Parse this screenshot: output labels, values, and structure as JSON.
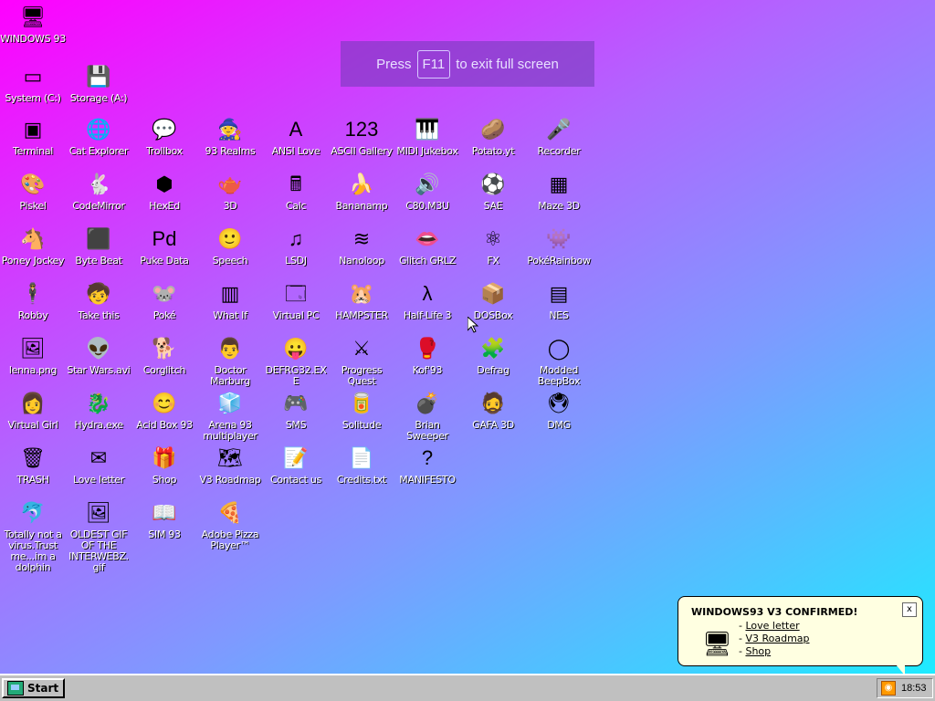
{
  "fullscreen_banner": {
    "press": "Press",
    "key": "F11",
    "rest": "to exit full screen"
  },
  "desktop_icons": [
    {
      "label": "WINDOWS 93",
      "glyph": "🖥"
    },
    {
      "label": "System (C:)",
      "glyph": "▭"
    },
    {
      "label": "Storage (A:)",
      "glyph": "💾"
    },
    {
      "label": "Terminal",
      "glyph": "▣"
    },
    {
      "label": "Cat Explorer",
      "glyph": "🌐"
    },
    {
      "label": "Trollbox",
      "glyph": "💬"
    },
    {
      "label": "93 Realms",
      "glyph": "🧙"
    },
    {
      "label": "ANSI Love",
      "glyph": "A"
    },
    {
      "label": "ASCII Gallery",
      "glyph": "123"
    },
    {
      "label": "MIDI Jukebox",
      "glyph": "🎹"
    },
    {
      "label": "Potato.yt",
      "glyph": "🥔"
    },
    {
      "label": "Recorder",
      "glyph": "🎤"
    },
    {
      "label": "Piskel",
      "glyph": "🎨"
    },
    {
      "label": "CodeMirror",
      "glyph": "🐇"
    },
    {
      "label": "HexEd",
      "glyph": "⬢"
    },
    {
      "label": "3D",
      "glyph": "🫖"
    },
    {
      "label": "Calc",
      "glyph": "🖩"
    },
    {
      "label": "Bananamp",
      "glyph": "🍌"
    },
    {
      "label": "C80.M3U",
      "glyph": "🔊"
    },
    {
      "label": "SAE",
      "glyph": "⚽"
    },
    {
      "label": "Maze 3D",
      "glyph": "▦"
    },
    {
      "label": "Poney Jockey",
      "glyph": "🐴"
    },
    {
      "label": "Byte Beat",
      "glyph": "⬛"
    },
    {
      "label": "Puke Data",
      "glyph": "Pd"
    },
    {
      "label": "Speech",
      "glyph": "🙂"
    },
    {
      "label": "LSDJ",
      "glyph": "♫"
    },
    {
      "label": "Nanoloop",
      "glyph": "≋"
    },
    {
      "label": "Glitch GRLZ",
      "glyph": "👄"
    },
    {
      "label": "FX",
      "glyph": "⚛"
    },
    {
      "label": "PokéRainbow",
      "glyph": "👾"
    },
    {
      "label": "Robby",
      "glyph": "🕴"
    },
    {
      "label": "Take this",
      "glyph": "🧒"
    },
    {
      "label": "Poké",
      "glyph": "🐭"
    },
    {
      "label": "What If",
      "glyph": "▥"
    },
    {
      "label": "Virtual PC",
      "glyph": "🗔"
    },
    {
      "label": "HAMPSTER",
      "glyph": "🐹"
    },
    {
      "label": "Half-Life 3",
      "glyph": "λ"
    },
    {
      "label": "DOSBox",
      "glyph": "📦"
    },
    {
      "label": "NES",
      "glyph": "▤"
    },
    {
      "label": "lenna.png",
      "glyph": "🖼"
    },
    {
      "label": "Star Wars.avi",
      "glyph": "👽"
    },
    {
      "label": "Corglitch",
      "glyph": "🐕"
    },
    {
      "label": "Doctor Marburg",
      "glyph": "👨"
    },
    {
      "label": "DEFRG32.EXE",
      "glyph": "😛"
    },
    {
      "label": "Progress Quest",
      "glyph": "⚔"
    },
    {
      "label": "Kof'93",
      "glyph": "🥊"
    },
    {
      "label": "Defrag",
      "glyph": "🧩"
    },
    {
      "label": "Modded BeepBox",
      "glyph": "◯"
    },
    {
      "label": "Virtual Girl",
      "glyph": "👩"
    },
    {
      "label": "Hydra.exe",
      "glyph": "🐉"
    },
    {
      "label": "Acid Box 93",
      "glyph": "😊"
    },
    {
      "label": "Arena 93 multiplayer",
      "glyph": "🧊"
    },
    {
      "label": "SMS",
      "glyph": "🎮"
    },
    {
      "label": "Solitude",
      "glyph": "🥫"
    },
    {
      "label": "Brian Sweeper",
      "glyph": "💣"
    },
    {
      "label": "GAFA 3D",
      "glyph": "🧔"
    },
    {
      "label": "DMG",
      "glyph": "🖲"
    },
    {
      "label": "TRASH",
      "glyph": "🗑"
    },
    {
      "label": "Love letter",
      "glyph": "✉"
    },
    {
      "label": "Shop",
      "glyph": "🎁"
    },
    {
      "label": "V3 Roadmap",
      "glyph": "🗺"
    },
    {
      "label": "Contact us",
      "glyph": "📝"
    },
    {
      "label": "Credits.txt",
      "glyph": "📄"
    },
    {
      "label": "MANIFESTO",
      "glyph": "?"
    },
    {
      "label": "Totally not a virus.Trust me...im a dolphin",
      "glyph": "🐬"
    },
    {
      "label": "OLDEST GIF OF THE INTERWEBZ.gif",
      "glyph": "🖼"
    },
    {
      "label": "SIM 93",
      "glyph": "📖"
    },
    {
      "label": "Adobe Pizza Player™",
      "glyph": "🍕"
    }
  ],
  "notification": {
    "title": "WINDOWS93 V3 CONFIRMED!",
    "close": "x",
    "links": [
      "Love letter",
      "V3 Roadmap",
      "Shop"
    ]
  },
  "taskbar": {
    "start_label": "Start",
    "clock": "18:53"
  },
  "colors": {
    "taskbar": "#c0c0c0",
    "notify_bg": "#ffffe1"
  }
}
